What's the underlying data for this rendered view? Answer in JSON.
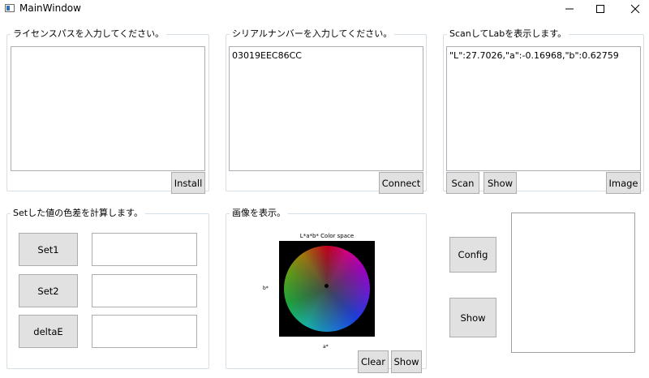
{
  "window": {
    "title": "MainWindow"
  },
  "license_group": {
    "label": "ライセンスパスを入力してください。",
    "path_value": "",
    "install_button": "Install"
  },
  "serial_group": {
    "label": "シリアルナンバーを入力してください。",
    "serial_value": "03019EEC86CC",
    "connect_button": "Connect"
  },
  "scan_group": {
    "label": "ScanしてLabを表示します。",
    "result_value": "\"L\":27.7026,\"a\":-0.16968,\"b\":0.62759",
    "scan_button": "Scan",
    "show_button": "Show",
    "image_button": "Image"
  },
  "delta_group": {
    "label": "Setした値の色差を計算します。",
    "set1_button": "Set1",
    "set1_value": "",
    "set2_button": "Set2",
    "set2_value": "",
    "deltae_button": "deltaE",
    "deltae_value": ""
  },
  "image_group": {
    "label": "画像を表示。",
    "clear_button": "Clear",
    "show_button": "Show"
  },
  "chart_data": {
    "type": "scatter",
    "title": "L*a*b* Color space",
    "xlabel": "a*",
    "ylabel": "b*",
    "points": [
      {
        "x": -0.16968,
        "y": 0.62759
      }
    ]
  },
  "side_panel": {
    "config_button": "Config",
    "show_button": "Show"
  },
  "icons": {
    "app": "window-app-icon",
    "minimize": "minimize-icon",
    "maximize": "maximize-icon",
    "close": "close-icon"
  }
}
